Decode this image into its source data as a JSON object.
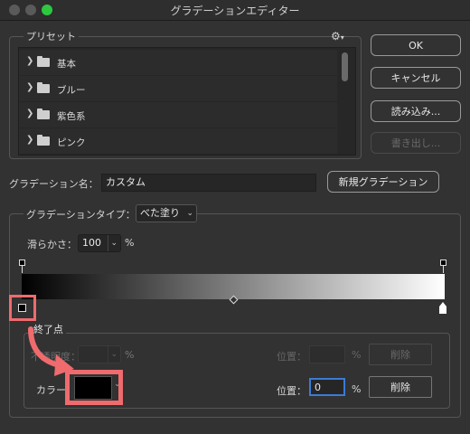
{
  "window": {
    "title": "グラデーションエディター"
  },
  "presets": {
    "heading": "プリセット",
    "items": [
      {
        "label": "基本"
      },
      {
        "label": "ブルー"
      },
      {
        "label": "紫色系"
      },
      {
        "label": "ピンク"
      }
    ]
  },
  "buttons": {
    "ok": "OK",
    "cancel": "キャンセル",
    "load": "読み込み...",
    "export": "書き出し..."
  },
  "gradient_name": {
    "label": "グラデーション名：",
    "value": "カスタム",
    "new_button": "新規グラデーション"
  },
  "gradient_type": {
    "label": "グラデーションタイプ：",
    "value": "べた塗り"
  },
  "smoothness": {
    "label": "滑らかさ：",
    "value": "100",
    "unit": "%"
  },
  "stops": {
    "heading": "終了点",
    "opacity_label": "不透明度：",
    "opacity_unit": "%",
    "opacity_position_label": "位置：",
    "opacity_position_unit": "%",
    "opacity_delete": "削除",
    "color_label": "カラー：",
    "color_value": "#000000",
    "color_position_label": "位置：",
    "color_position_value": "0",
    "color_position_unit": "%",
    "color_delete": "削除"
  },
  "colors": {
    "annotation": "#ef6b6e"
  }
}
